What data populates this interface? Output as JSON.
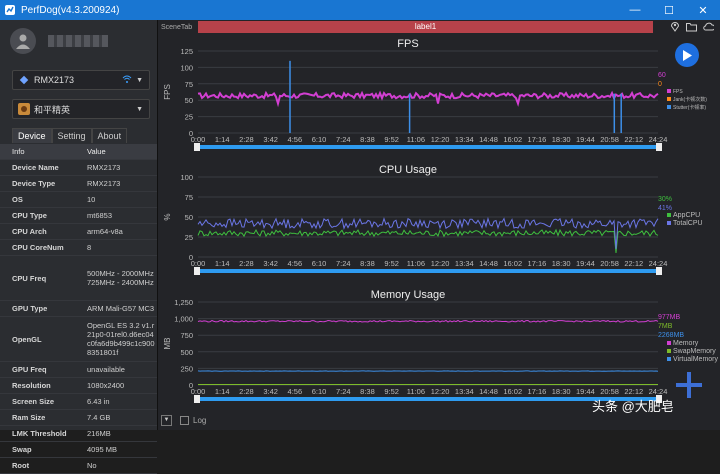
{
  "window": {
    "title": "PerfDog(v4.3.200924)"
  },
  "device_select": {
    "label": "RMX2173"
  },
  "app_select": {
    "label": "和平精英"
  },
  "tabs": [
    {
      "label": "Device"
    },
    {
      "label": "Setting"
    },
    {
      "label": "About"
    }
  ],
  "info_table": {
    "headers": [
      "Info",
      "Value"
    ],
    "rows": [
      {
        "k": "Device Name",
        "v": "RMX2173"
      },
      {
        "k": "Device Type",
        "v": "RMX2173"
      },
      {
        "k": "OS",
        "v": "10"
      },
      {
        "k": "CPU Type",
        "v": "mt6853"
      },
      {
        "k": "CPU Arch",
        "v": "arm64-v8a"
      },
      {
        "k": "CPU CoreNum",
        "v": "8"
      },
      {
        "k": "CPU Freq",
        "v": "500MHz - 2000MHz 725MHz - 2400MHz"
      },
      {
        "k": "GPU Type",
        "v": "ARM Mali-G57 MC3"
      },
      {
        "k": "OpenGL",
        "v": "OpenGL ES 3.2 v1.r21p0-01rel0.d6ec04c0fa6d9b499c1c9008351801f"
      },
      {
        "k": "GPU Freq",
        "v": "unavailable"
      },
      {
        "k": "Resolution",
        "v": "1080x2400"
      },
      {
        "k": "Screen Size",
        "v": "6.43 in"
      },
      {
        "k": "Ram Size",
        "v": "7.4 GB"
      },
      {
        "k": "LMK Threshold",
        "v": "216MB"
      },
      {
        "k": "Swap",
        "v": "4095 MB"
      },
      {
        "k": "Root",
        "v": "No"
      }
    ]
  },
  "scene_tab": "SceneTab",
  "label_bar": "label1",
  "time_ticks": [
    "0:00",
    "1:14",
    "2:28",
    "3:42",
    "4:56",
    "6:10",
    "7:24",
    "8:38",
    "9:52",
    "11:06",
    "12:20",
    "13:34",
    "14:48",
    "16:02",
    "17:16",
    "18:30",
    "19:44",
    "20:58",
    "22:12",
    "24:24"
  ],
  "chart_data": [
    {
      "type": "line",
      "title": "FPS",
      "ylabel": "FPS",
      "ylim": [
        0,
        125
      ],
      "yticks": [
        "125",
        "100",
        "75",
        "50",
        "25",
        "0"
      ],
      "series": [
        {
          "name": "FPS",
          "color": "#d23fd2",
          "base": 57,
          "noise": 4
        },
        {
          "name": "Jank(卡顿次数)",
          "color": "#ff8c1a",
          "base": 0,
          "noise": 0
        },
        {
          "name": "Stutter(卡顿率)",
          "color": "#3d8fe8",
          "base": 0,
          "noise": 0
        }
      ],
      "readouts": [
        {
          "text": "60",
          "color": "#d23fd2"
        },
        {
          "text": "0",
          "color": "#ff8c1a"
        }
      ]
    },
    {
      "type": "line",
      "title": "CPU Usage",
      "ylabel": "%",
      "ylim": [
        0,
        100
      ],
      "yticks": [
        "100",
        "75",
        "50",
        "25",
        "0"
      ],
      "series": [
        {
          "name": "AppCPU",
          "color": "#3fbf3f",
          "base": 30,
          "noise": 4
        },
        {
          "name": "TotalCPU",
          "color": "#6b76e6",
          "base": 42,
          "noise": 6
        }
      ],
      "readouts": [
        {
          "text": "30%",
          "color": "#3fbf3f"
        },
        {
          "text": "41%",
          "color": "#6b76e6"
        }
      ]
    },
    {
      "type": "line",
      "title": "Memory Usage",
      "ylabel": "MB",
      "ylim": [
        0,
        1250
      ],
      "yticks": [
        "1,250",
        "1,000",
        "750",
        "500",
        "250",
        "0"
      ],
      "series": [
        {
          "name": "Memory",
          "color": "#d23fd2",
          "base": 960,
          "noise": 12
        },
        {
          "name": "SwapMemory",
          "color": "#7dbb2a",
          "base": 8,
          "noise": 0
        },
        {
          "name": "VirtualMemory",
          "color": "#3d8fe8",
          "base": 210,
          "noise": 2
        }
      ],
      "readouts": [
        {
          "text": "977MB",
          "color": "#d23fd2"
        },
        {
          "text": "7MB",
          "color": "#7dbb2a"
        },
        {
          "text": "2268MB",
          "color": "#3d8fe8"
        }
      ]
    }
  ],
  "log_label": "Log",
  "watermark": "头条 @大肥皂"
}
